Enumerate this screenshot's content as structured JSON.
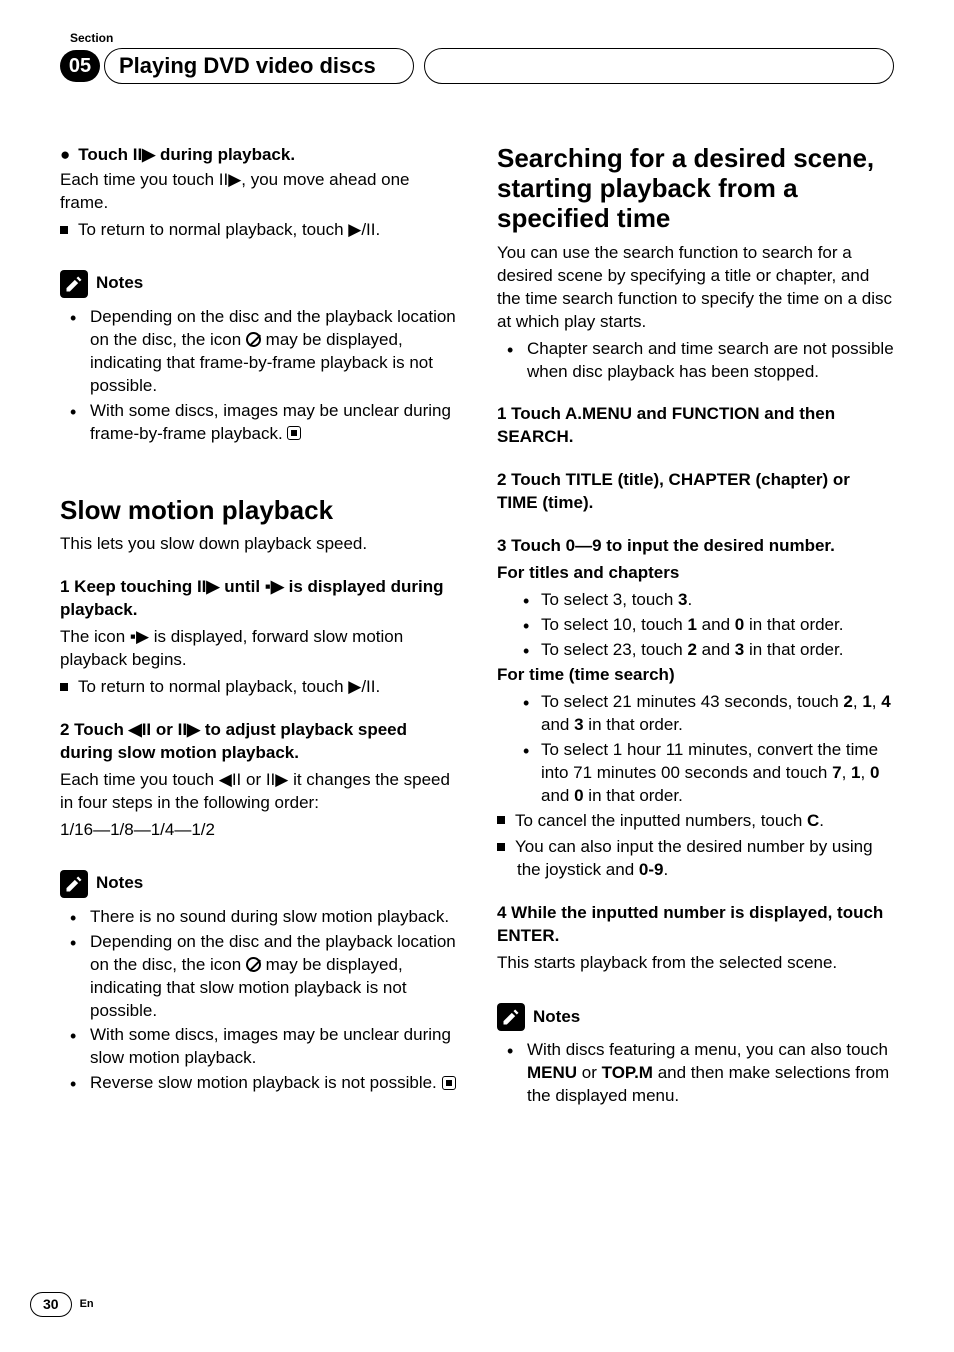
{
  "header": {
    "section_label": "Section",
    "section_number": "05",
    "title": "Playing DVD video discs"
  },
  "left": {
    "touch_lead": "Touch II▶ during playback.",
    "touch_desc": "Each time you touch II▶, you move ahead one frame.",
    "touch_return": "To return to normal playback, touch ▶/II.",
    "notes1_title": "Notes",
    "notes1_a_pre": "Depending on the disc and the playback location on the disc, the icon ",
    "notes1_a_post": " may be displayed, indicating that frame-by-frame playback is not possible.",
    "notes1_b": "With some discs, images may be unclear during frame-by-frame playback.",
    "slow_title": "Slow motion playback",
    "slow_intro": "This lets you slow down playback speed.",
    "slow_step1": "1    Keep touching II▶ until ▪▶ is displayed during playback.",
    "slow_step1_desc": "The icon ▪▶ is displayed, forward slow motion playback begins.",
    "slow_step1_return": "To return to normal playback, touch ▶/II.",
    "slow_step2": "2    Touch ◀II or II▶ to adjust playback speed during slow motion playback.",
    "slow_step2_desc": "Each time you touch ◀II or II▶ it changes the speed in four steps in the following order:",
    "slow_step2_seq": "1/16—1/8—1/4—1/2",
    "notes2_title": "Notes",
    "notes2_a": "There is no sound during slow motion playback.",
    "notes2_b_pre": "Depending on the disc and the playback location on the disc, the icon ",
    "notes2_b_post": " may be displayed, indicating that slow motion playback is not possible.",
    "notes2_c": "With some discs, images may be unclear during slow motion playback.",
    "notes2_d": "Reverse slow motion playback is not possible."
  },
  "right": {
    "search_title": "Searching for a desired scene, starting playback from a specified time",
    "search_intro": "You can use the search function to search for a desired scene by specifying a title or chapter, and the time search function to specify the time on a disc at which play starts.",
    "search_bullet": "Chapter search and time search are not possible when disc playback has been stopped.",
    "step1": "1    Touch A.MENU and FUNCTION and then SEARCH.",
    "step2": "2    Touch TITLE (title), CHAPTER (chapter) or TIME (time).",
    "step3": "3    Touch 0—9 to input the desired number.",
    "titles_hdr": "For titles and chapters",
    "t_a_pre": "To select 3, touch ",
    "t_a_b": "3",
    "t_a_post": ".",
    "t_b_pre": "To select 10, touch ",
    "t_b_b1": "1",
    "t_b_mid": " and ",
    "t_b_b2": "0",
    "t_b_post": " in that order.",
    "t_c_pre": "To select 23, touch ",
    "t_c_b1": "2",
    "t_c_mid": " and ",
    "t_c_b2": "3",
    "t_c_post": " in that order.",
    "time_hdr": "For time (time search)",
    "time_a_pre": "To select 21 minutes 43 seconds, touch ",
    "time_a_b1": "2",
    "time_a_s1": ", ",
    "time_a_b2": "1",
    "time_a_s2": ", ",
    "time_a_b3": "4",
    "time_a_mid": " and ",
    "time_a_b4": "3",
    "time_a_post": " in that order.",
    "time_b_pre": "To select 1 hour 11 minutes, convert the time into 71 minutes 00 seconds and touch ",
    "time_b_b1": "7",
    "time_b_s1": ", ",
    "time_b_b2": "1",
    "time_b_s2": ", ",
    "time_b_b3": "0",
    "time_b_mid": " and ",
    "time_b_b4": "0",
    "time_b_post": " in that order.",
    "cancel_pre": "To cancel the inputted numbers, touch ",
    "cancel_b": "C",
    "cancel_post": ".",
    "joy_pre": "You can also input the desired number by using the joystick and ",
    "joy_b": "0-9",
    "joy_post": ".",
    "step4": "4    While the inputted number is displayed, touch ENTER.",
    "step4_desc": "This starts playback from the selected scene.",
    "notes3_title": "Notes",
    "notes3_a_pre": "With discs featuring a menu, you can also touch ",
    "notes3_a_b1": "MENU",
    "notes3_a_mid": " or ",
    "notes3_a_b2": "TOP.M",
    "notes3_a_post": " and then make selections from the displayed menu."
  },
  "footer": {
    "page": "30",
    "lang": "En"
  }
}
